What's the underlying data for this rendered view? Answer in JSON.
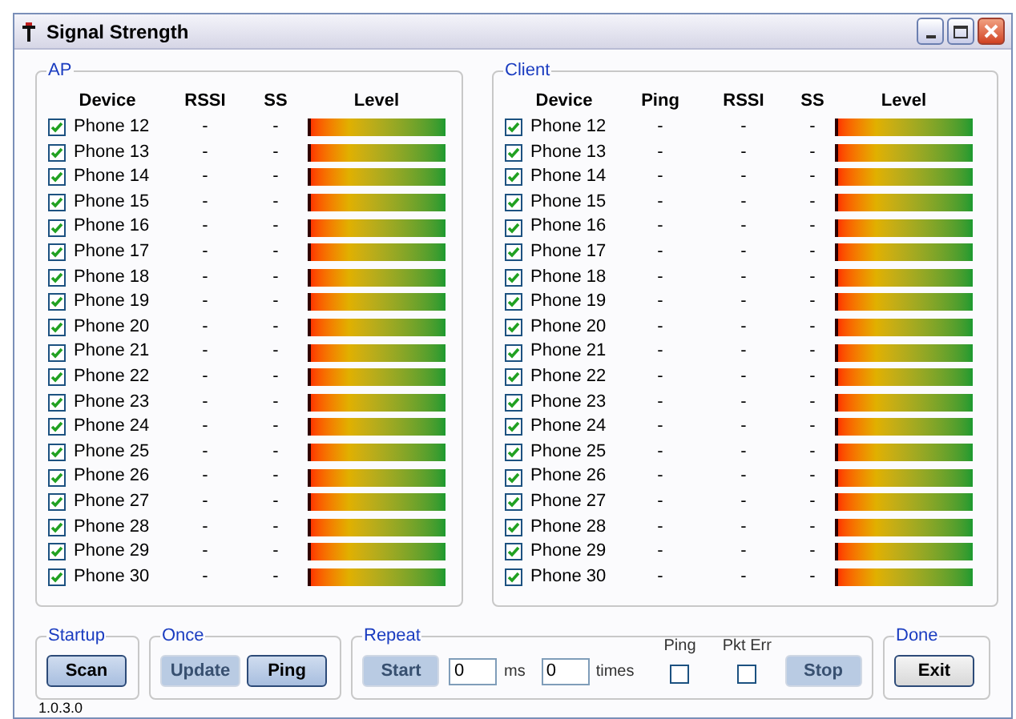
{
  "window": {
    "title": "Signal Strength"
  },
  "ap": {
    "title": "AP",
    "columns": [
      "Device",
      "RSSI",
      "SS",
      "Level"
    ],
    "rows": [
      {
        "checked": true,
        "device": "Phone 12",
        "rssi": "-",
        "ss": "-",
        "level": 0
      },
      {
        "checked": true,
        "device": "Phone 13",
        "rssi": "-",
        "ss": "-",
        "level": 0
      },
      {
        "checked": true,
        "device": "Phone 14",
        "rssi": "-",
        "ss": "-",
        "level": 0
      },
      {
        "checked": true,
        "device": "Phone 15",
        "rssi": "-",
        "ss": "-",
        "level": 0
      },
      {
        "checked": true,
        "device": "Phone 16",
        "rssi": "-",
        "ss": "-",
        "level": 0
      },
      {
        "checked": true,
        "device": "Phone 17",
        "rssi": "-",
        "ss": "-",
        "level": 0
      },
      {
        "checked": true,
        "device": "Phone 18",
        "rssi": "-",
        "ss": "-",
        "level": 0
      },
      {
        "checked": true,
        "device": "Phone 19",
        "rssi": "-",
        "ss": "-",
        "level": 0
      },
      {
        "checked": true,
        "device": "Phone 20",
        "rssi": "-",
        "ss": "-",
        "level": 0
      },
      {
        "checked": true,
        "device": "Phone 21",
        "rssi": "-",
        "ss": "-",
        "level": 0
      },
      {
        "checked": true,
        "device": "Phone 22",
        "rssi": "-",
        "ss": "-",
        "level": 0
      },
      {
        "checked": true,
        "device": "Phone 23",
        "rssi": "-",
        "ss": "-",
        "level": 0
      },
      {
        "checked": true,
        "device": "Phone 24",
        "rssi": "-",
        "ss": "-",
        "level": 0
      },
      {
        "checked": true,
        "device": "Phone 25",
        "rssi": "-",
        "ss": "-",
        "level": 0
      },
      {
        "checked": true,
        "device": "Phone 26",
        "rssi": "-",
        "ss": "-",
        "level": 0
      },
      {
        "checked": true,
        "device": "Phone 27",
        "rssi": "-",
        "ss": "-",
        "level": 0
      },
      {
        "checked": true,
        "device": "Phone 28",
        "rssi": "-",
        "ss": "-",
        "level": 0
      },
      {
        "checked": true,
        "device": "Phone 29",
        "rssi": "-",
        "ss": "-",
        "level": 0
      },
      {
        "checked": true,
        "device": "Phone 30",
        "rssi": "-",
        "ss": "-",
        "level": 0
      }
    ]
  },
  "client": {
    "title": "Client",
    "columns": [
      "Device",
      "Ping",
      "RSSI",
      "SS",
      "Level"
    ],
    "rows": [
      {
        "checked": true,
        "device": "Phone 12",
        "ping": "-",
        "rssi": "-",
        "ss": "-",
        "level": 0
      },
      {
        "checked": true,
        "device": "Phone 13",
        "ping": "-",
        "rssi": "-",
        "ss": "-",
        "level": 0
      },
      {
        "checked": true,
        "device": "Phone 14",
        "ping": "-",
        "rssi": "-",
        "ss": "-",
        "level": 0
      },
      {
        "checked": true,
        "device": "Phone 15",
        "ping": "-",
        "rssi": "-",
        "ss": "-",
        "level": 0
      },
      {
        "checked": true,
        "device": "Phone 16",
        "ping": "-",
        "rssi": "-",
        "ss": "-",
        "level": 0
      },
      {
        "checked": true,
        "device": "Phone 17",
        "ping": "-",
        "rssi": "-",
        "ss": "-",
        "level": 0
      },
      {
        "checked": true,
        "device": "Phone 18",
        "ping": "-",
        "rssi": "-",
        "ss": "-",
        "level": 0
      },
      {
        "checked": true,
        "device": "Phone 19",
        "ping": "-",
        "rssi": "-",
        "ss": "-",
        "level": 0
      },
      {
        "checked": true,
        "device": "Phone 20",
        "ping": "-",
        "rssi": "-",
        "ss": "-",
        "level": 0
      },
      {
        "checked": true,
        "device": "Phone 21",
        "ping": "-",
        "rssi": "-",
        "ss": "-",
        "level": 0
      },
      {
        "checked": true,
        "device": "Phone 22",
        "ping": "-",
        "rssi": "-",
        "ss": "-",
        "level": 0
      },
      {
        "checked": true,
        "device": "Phone 23",
        "ping": "-",
        "rssi": "-",
        "ss": "-",
        "level": 0
      },
      {
        "checked": true,
        "device": "Phone 24",
        "ping": "-",
        "rssi": "-",
        "ss": "-",
        "level": 0
      },
      {
        "checked": true,
        "device": "Phone 25",
        "ping": "-",
        "rssi": "-",
        "ss": "-",
        "level": 0
      },
      {
        "checked": true,
        "device": "Phone 26",
        "ping": "-",
        "rssi": "-",
        "ss": "-",
        "level": 0
      },
      {
        "checked": true,
        "device": "Phone 27",
        "ping": "-",
        "rssi": "-",
        "ss": "-",
        "level": 0
      },
      {
        "checked": true,
        "device": "Phone 28",
        "ping": "-",
        "rssi": "-",
        "ss": "-",
        "level": 0
      },
      {
        "checked": true,
        "device": "Phone 29",
        "ping": "-",
        "rssi": "-",
        "ss": "-",
        "level": 0
      },
      {
        "checked": true,
        "device": "Phone 30",
        "ping": "-",
        "rssi": "-",
        "ss": "-",
        "level": 0
      }
    ]
  },
  "startup": {
    "title": "Startup",
    "scan_button": {
      "label": "Scan",
      "disabled": false
    }
  },
  "once": {
    "title": "Once",
    "update_button": {
      "label": "Update",
      "disabled": true
    },
    "ping_button": {
      "label": "Ping",
      "disabled": false
    }
  },
  "repeat": {
    "title": "Repeat",
    "start_button": {
      "label": "Start",
      "disabled": true
    },
    "interval": {
      "value": "0",
      "unit": "ms"
    },
    "count": {
      "value": "0",
      "unit": "times"
    },
    "ping": {
      "label": "Ping",
      "checked": false
    },
    "pkt_err": {
      "label": "Pkt Err",
      "checked": false
    },
    "stop_button": {
      "label": "Stop",
      "disabled": true
    }
  },
  "done": {
    "title": "Done",
    "exit_button": {
      "label": "Exit",
      "disabled": false
    }
  },
  "version": "1.0.3.0"
}
